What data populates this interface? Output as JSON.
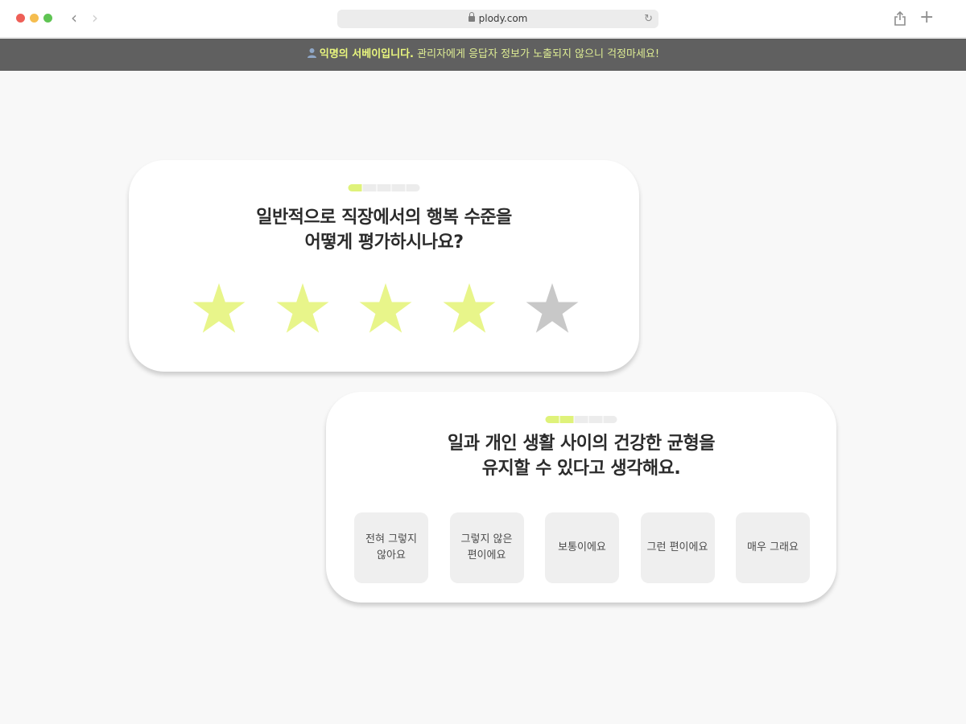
{
  "browser": {
    "url": "plody.com",
    "back_glyph": "‹",
    "forward_glyph": "›",
    "reload_glyph": "↻",
    "plus_glyph": "+"
  },
  "banner": {
    "icon": "person-icon",
    "strong": "익명의 서베이입니다.",
    "rest": " 관리자에게 응답자 정보가 노출되지 않으니 걱정마세요!"
  },
  "colors": {
    "accent": "#dff27a",
    "star_filled": "#e8f58a",
    "star_empty": "#c8c8c8",
    "banner_bg": "#606060"
  },
  "questions": [
    {
      "progress": {
        "filled": 1,
        "total": 5
      },
      "title_lines": [
        "일반적으로 직장에서의 행복 수준을",
        "어떻게 평가하시나요?"
      ],
      "rating": {
        "value": 4,
        "max": 5
      }
    },
    {
      "progress": {
        "filled": 2,
        "total": 5
      },
      "title_lines": [
        "일과 개인 생활 사이의 건강한 균형을",
        "유지할 수 있다고 생각해요."
      ],
      "options": [
        {
          "lines": [
            "전혀 그렇지",
            "않아요"
          ]
        },
        {
          "lines": [
            "그렇지 않은",
            "편이에요"
          ]
        },
        {
          "lines": [
            "보통이에요"
          ]
        },
        {
          "lines": [
            "그런 편이에요"
          ]
        },
        {
          "lines": [
            "매우 그래요"
          ]
        }
      ]
    }
  ]
}
